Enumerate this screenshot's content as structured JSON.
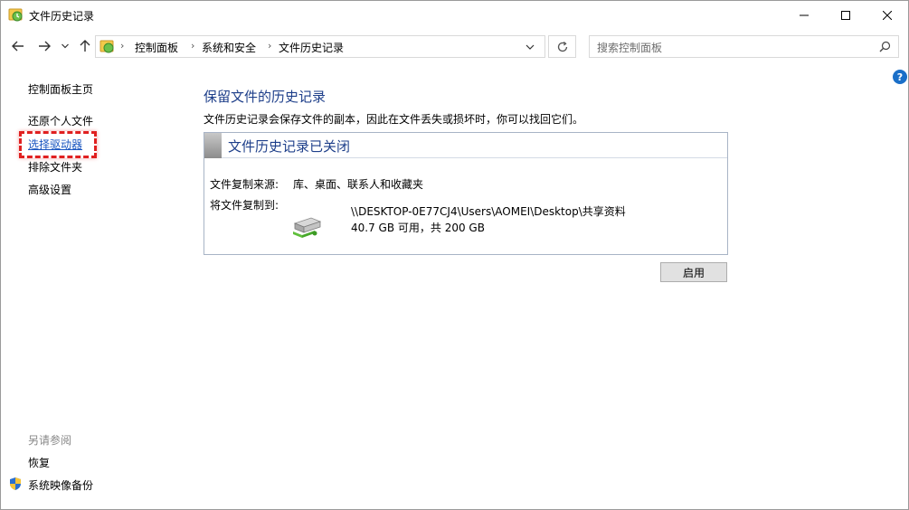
{
  "window": {
    "title": "文件历史记录"
  },
  "breadcrumb": [
    "控制面板",
    "系统和安全",
    "文件历史记录"
  ],
  "search": {
    "placeholder": "搜索控制面板"
  },
  "help": {
    "glyph": "?"
  },
  "sidebar": {
    "items": [
      {
        "label": "控制面板主页",
        "selected": false
      },
      {
        "label": "还原个人文件",
        "selected": false
      },
      {
        "label": "选择驱动器",
        "selected": true
      },
      {
        "label": "排除文件夹",
        "selected": false
      },
      {
        "label": "高级设置",
        "selected": false
      }
    ],
    "see_also_title": "另请参阅",
    "see_also": [
      {
        "label": "恢复",
        "icon": "none"
      },
      {
        "label": "系统映像备份",
        "icon": "shield-icon"
      }
    ]
  },
  "main": {
    "title": "保留文件的历史记录",
    "description": "文件历史记录会保存文件的副本，因此在文件丢失或损坏时，你可以找回它们。",
    "status_title": "文件历史记录已关闭",
    "copy_from_label": "文件复制来源:",
    "copy_from_value": "库、桌面、联系人和收藏夹",
    "copy_to_label": "将文件复制到:",
    "drive_path": "\\\\DESKTOP-0E77CJ4\\Users\\AOMEI\\Desktop\\共享资料",
    "drive_space": "40.7 GB 可用，共 200 GB",
    "enable_button": "启用"
  },
  "colors": {
    "accent_title": "#1e3f8a",
    "link_selected": "#1a56c0",
    "highlight": "#e02020",
    "help": "#1a6fc8"
  }
}
